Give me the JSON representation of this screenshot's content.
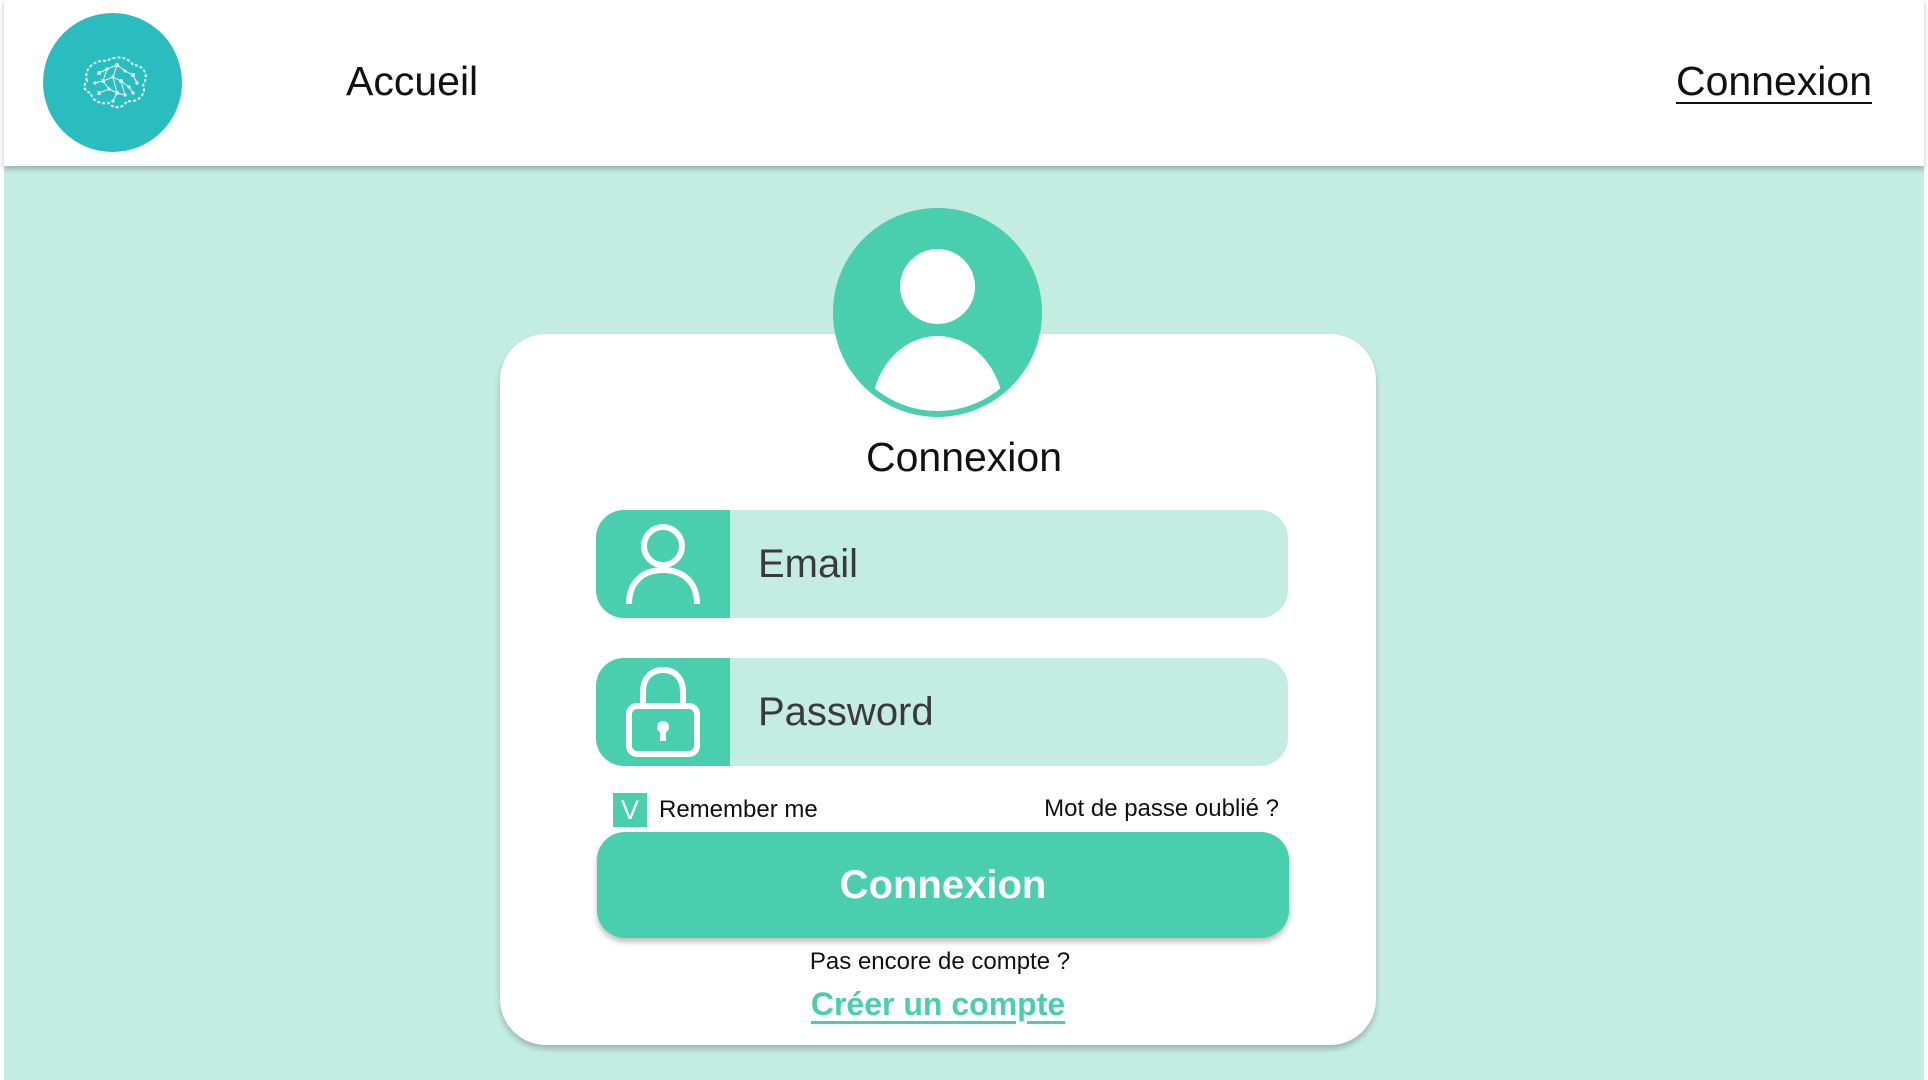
{
  "navbar": {
    "home_label": "Accueil",
    "login_label": "Connexion",
    "logo_icon": "brain-icon"
  },
  "login_card": {
    "avatar_icon": "user-avatar-icon",
    "title": "Connexion",
    "email": {
      "placeholder": "Email",
      "value": "",
      "icon": "user-outline-icon"
    },
    "password": {
      "placeholder": "Password",
      "value": "",
      "icon": "lock-icon"
    },
    "remember": {
      "check_mark": "V",
      "label": "Remember me",
      "checked": true
    },
    "forgot_label": "Mot de passe oublié ?",
    "submit_label": "Connexion",
    "no_account_text": "Pas encore de compte ?",
    "create_account_label": "Créer un compte"
  },
  "colors": {
    "background": "#c3ede1",
    "accent": "#49cfad",
    "logo": "#29bdbf",
    "card": "#ffffff"
  }
}
